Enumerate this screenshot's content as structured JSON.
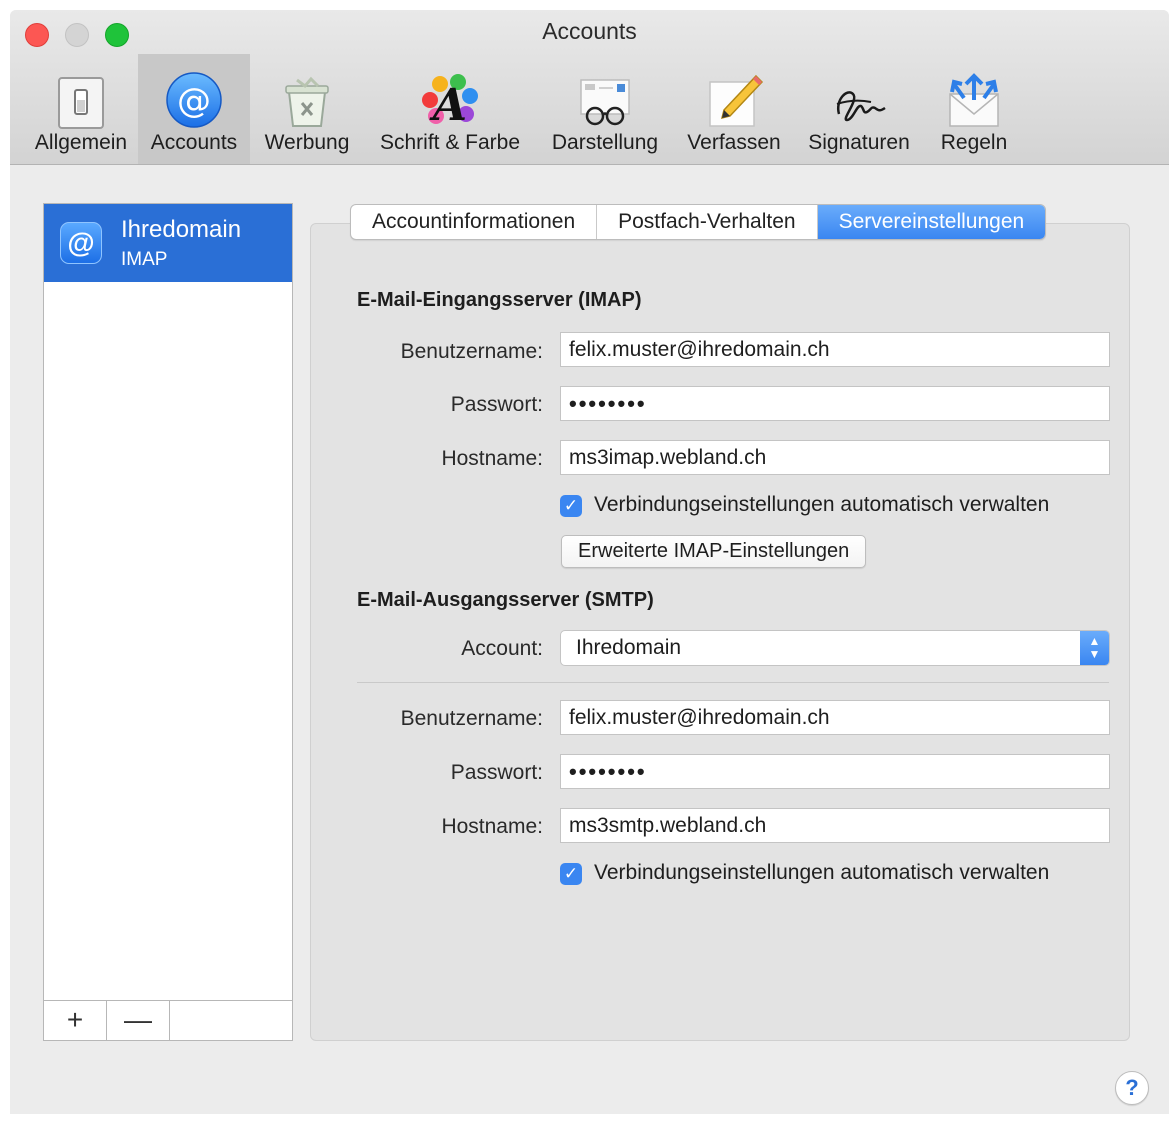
{
  "window": {
    "title": "Accounts"
  },
  "toolbar": {
    "items": [
      {
        "label": "Allgemein",
        "icon": "switch-icon"
      },
      {
        "label": "Accounts",
        "icon": "at-icon"
      },
      {
        "label": "Werbung",
        "icon": "junk-trash-icon"
      },
      {
        "label": "Schrift & Farbe",
        "icon": "font-color-icon"
      },
      {
        "label": "Darstellung",
        "icon": "glasses-icon"
      },
      {
        "label": "Verfassen",
        "icon": "pencil-icon"
      },
      {
        "label": "Signaturen",
        "icon": "signature-icon"
      },
      {
        "label": "Regeln",
        "icon": "envelope-arrows-icon"
      }
    ],
    "active": "Accounts"
  },
  "sidebar": {
    "account": {
      "name": "Ihredomain",
      "type": "IMAP"
    },
    "add_label": "+",
    "remove_label": "—"
  },
  "tabs": [
    {
      "label": "Accountinformationen"
    },
    {
      "label": "Postfach-Verhalten"
    },
    {
      "label": "Servereinstellungen",
      "selected": true
    }
  ],
  "incoming": {
    "section_title": "E-Mail-Eingangsserver (IMAP)",
    "username_label": "Benutzername:",
    "username": "felix.muster@ihredomain.ch",
    "password_label": "Passwort:",
    "password": "••••••••",
    "hostname_label": "Hostname:",
    "hostname": "ms3imap.webland.ch",
    "auto_manage_label": "Verbindungseinstellungen automatisch verwalten",
    "auto_manage_checked": true,
    "advanced_button": "Erweiterte IMAP-Einstellungen"
  },
  "outgoing": {
    "section_title": "E-Mail-Ausgangsserver (SMTP)",
    "account_label": "Account:",
    "account_value": "Ihredomain",
    "username_label": "Benutzername:",
    "username": "felix.muster@ihredomain.ch",
    "password_label": "Passwort:",
    "password": "••••••••",
    "hostname_label": "Hostname:",
    "hostname": "ms3smtp.webland.ch",
    "auto_manage_label": "Verbindungseinstellungen automatisch verwalten",
    "auto_manage_checked": true
  },
  "help_label": "?",
  "colors": {
    "accent": "#3a86f1",
    "selection": "#2a6fd6"
  }
}
